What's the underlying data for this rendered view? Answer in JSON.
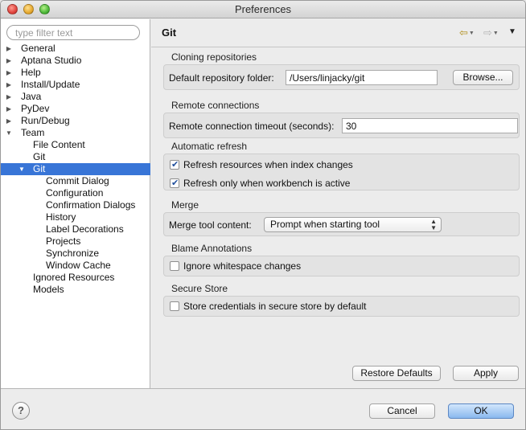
{
  "window": {
    "title": "Preferences"
  },
  "filter": {
    "placeholder": "type filter text",
    "value": ""
  },
  "tree": [
    {
      "label": "General",
      "level": 0,
      "twisty": "collapsed"
    },
    {
      "label": "Aptana Studio",
      "level": 0,
      "twisty": "collapsed"
    },
    {
      "label": "Help",
      "level": 0,
      "twisty": "collapsed"
    },
    {
      "label": "Install/Update",
      "level": 0,
      "twisty": "collapsed"
    },
    {
      "label": "Java",
      "level": 0,
      "twisty": "collapsed"
    },
    {
      "label": "PyDev",
      "level": 0,
      "twisty": "collapsed"
    },
    {
      "label": "Run/Debug",
      "level": 0,
      "twisty": "collapsed"
    },
    {
      "label": "Team",
      "level": 0,
      "twisty": "expanded"
    },
    {
      "label": "File Content",
      "level": 1,
      "twisty": "none"
    },
    {
      "label": "Git",
      "level": 1,
      "twisty": "none"
    },
    {
      "label": "Git",
      "level": 1,
      "twisty": "expanded",
      "selected": true
    },
    {
      "label": "Commit Dialog",
      "level": 2,
      "twisty": "none"
    },
    {
      "label": "Configuration",
      "level": 2,
      "twisty": "none"
    },
    {
      "label": "Confirmation Dialogs",
      "level": 2,
      "twisty": "none"
    },
    {
      "label": "History",
      "level": 2,
      "twisty": "none"
    },
    {
      "label": "Label Decorations",
      "level": 2,
      "twisty": "none"
    },
    {
      "label": "Projects",
      "level": 2,
      "twisty": "none"
    },
    {
      "label": "Synchronize",
      "level": 2,
      "twisty": "none"
    },
    {
      "label": "Window Cache",
      "level": 2,
      "twisty": "none"
    },
    {
      "label": "Ignored Resources",
      "level": 1,
      "twisty": "none"
    },
    {
      "label": "Models",
      "level": 1,
      "twisty": "none"
    }
  ],
  "page": {
    "title": "Git",
    "nav": {
      "back_icon": "back-arrow-icon",
      "forward_icon": "forward-arrow-icon",
      "menu_icon": "view-menu-icon"
    },
    "cloning": {
      "label": "Cloning repositories",
      "folder_label": "Default repository folder:",
      "folder_value": "/Users/linjacky/git",
      "browse_label": "Browse..."
    },
    "remote": {
      "label": "Remote connections",
      "timeout_label": "Remote connection timeout (seconds):",
      "timeout_value": "30"
    },
    "refresh": {
      "label": "Automatic refresh",
      "index_changes": {
        "label": "Refresh resources when index changes",
        "checked": true
      },
      "workbench_active": {
        "label": "Refresh only when workbench is active",
        "checked": true
      }
    },
    "merge": {
      "label": "Merge",
      "tool_label": "Merge tool content:",
      "tool_value": "Prompt when starting tool"
    },
    "blame": {
      "label": "Blame Annotations",
      "ignore_ws": {
        "label": "Ignore whitespace changes",
        "checked": false
      }
    },
    "secure": {
      "label": "Secure Store",
      "store_creds": {
        "label": "Store credentials in secure store by default",
        "checked": false
      }
    },
    "restore_defaults_label": "Restore Defaults",
    "apply_label": "Apply"
  },
  "footer": {
    "help_label": "?",
    "cancel_label": "Cancel",
    "ok_label": "OK"
  }
}
